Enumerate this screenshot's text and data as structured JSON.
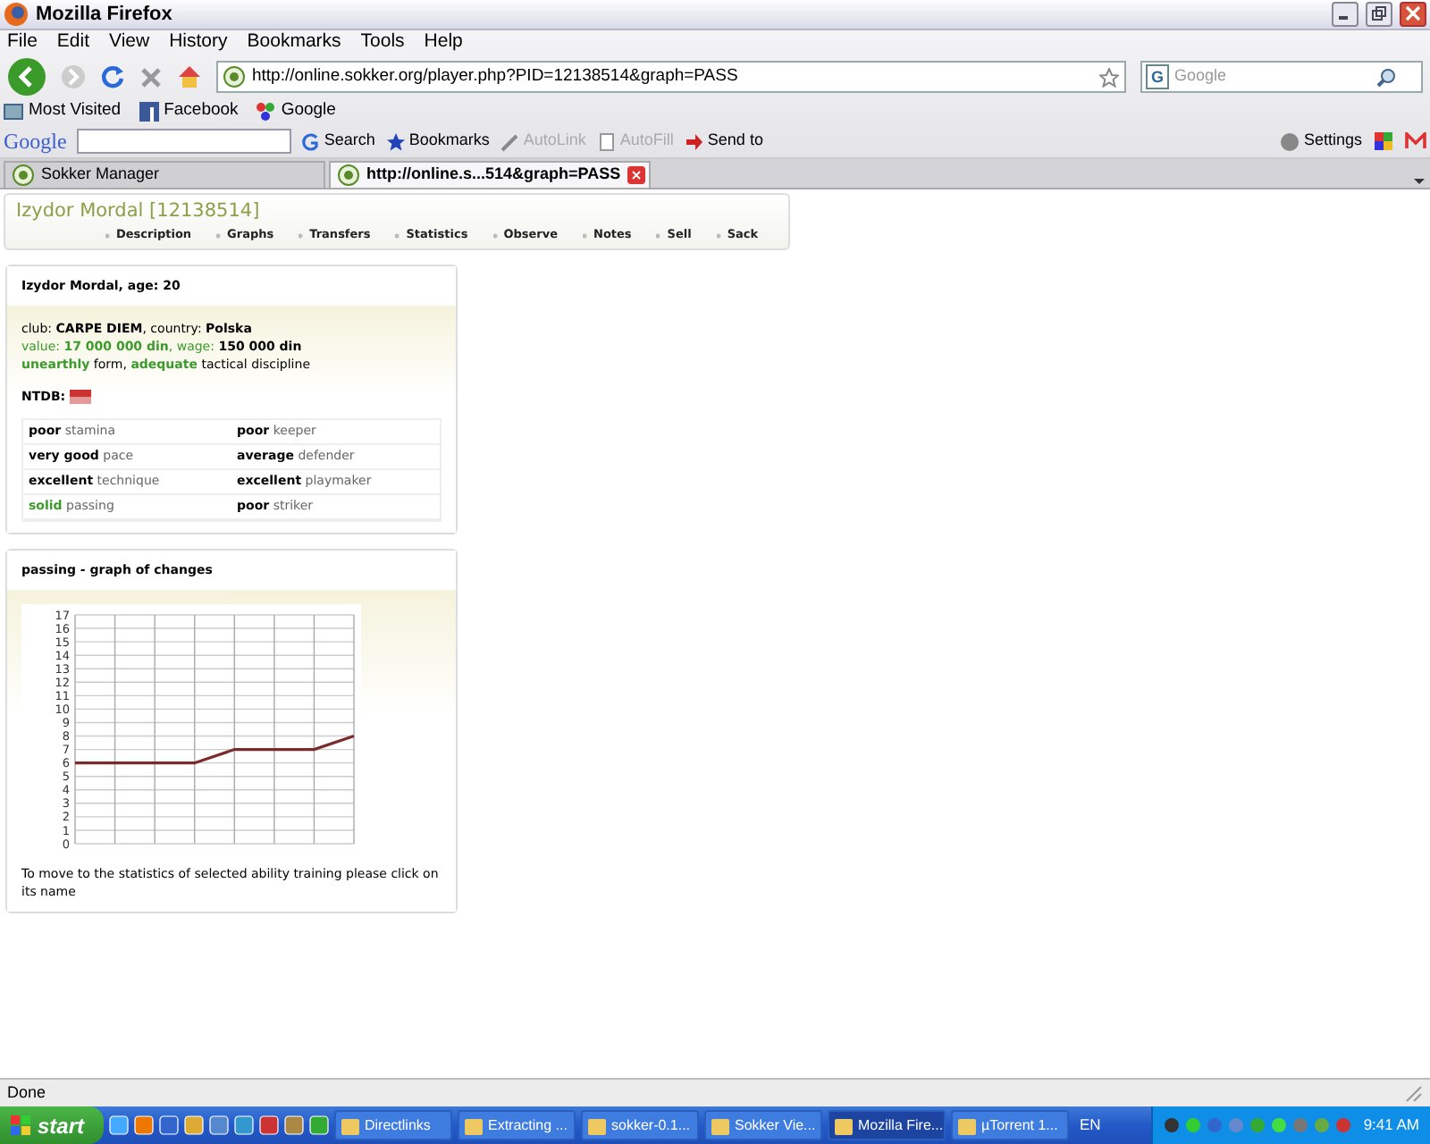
{
  "window": {
    "title": "Mozilla Firefox"
  },
  "menu": [
    "File",
    "Edit",
    "View",
    "History",
    "Bookmarks",
    "Tools",
    "Help"
  ],
  "address_bar": {
    "value": "http://online.sokker.org/player.php?PID=12138514&graph=PASS"
  },
  "search": {
    "engine": "G",
    "placeholder": "Google"
  },
  "bookmarks": [
    "Most Visited",
    "Facebook",
    "Google"
  ],
  "google_toolbar": {
    "logo": "Google",
    "search_label": "Search",
    "items": [
      {
        "label": "Bookmarks",
        "disabled": false
      },
      {
        "label": "AutoLink",
        "disabled": true
      },
      {
        "label": "AutoFill",
        "disabled": true
      },
      {
        "label": "Send to",
        "disabled": false
      }
    ],
    "settings": "Settings"
  },
  "tabs": [
    {
      "label": "Sokker Manager",
      "selected": false
    },
    {
      "label": "http://online.s...514&graph=PASS",
      "selected": true
    }
  ],
  "page": {
    "title": "Izydor Mordal [12138514]",
    "nav": [
      "Description",
      "Graphs",
      "Transfers",
      "Statistics",
      "Observe",
      "Notes",
      "Sell",
      "Sack"
    ],
    "player": {
      "heading": "Izydor Mordal, age: 20",
      "lines": [
        [
          {
            "text": "club: ",
            "kind": "plain"
          },
          {
            "text": "CARPE DIEM",
            "kind": "bold"
          },
          {
            "text": ", country: ",
            "kind": "plain"
          },
          {
            "text": "Polska",
            "kind": "bold"
          }
        ],
        [
          {
            "text": "value: ",
            "kind": "green"
          },
          {
            "text": "17 000 000 din",
            "kind": "greenbold"
          },
          {
            "text": ", wage: ",
            "kind": "green"
          },
          {
            "text": "150 000 din",
            "kind": "bold"
          }
        ],
        [
          {
            "text": "unearthly",
            "kind": "greenbold"
          },
          {
            "text": " form, ",
            "kind": "plain"
          },
          {
            "text": "adequate",
            "kind": "greenbold"
          },
          {
            "text": " tactical discipline",
            "kind": "plain"
          }
        ]
      ],
      "ntdb_label": "NTDB:",
      "skills": [
        {
          "level": "poor",
          "name": "stamina",
          "highlight": false
        },
        {
          "level": "poor",
          "name": "keeper",
          "highlight": false
        },
        {
          "level": "very good",
          "name": "pace",
          "highlight": false
        },
        {
          "level": "average",
          "name": "defender",
          "highlight": false
        },
        {
          "level": "excellent",
          "name": "technique",
          "highlight": false
        },
        {
          "level": "excellent",
          "name": "playmaker",
          "highlight": false
        },
        {
          "level": "solid",
          "name": "passing",
          "highlight": true
        },
        {
          "level": "poor",
          "name": "striker",
          "highlight": false
        }
      ]
    },
    "graph": {
      "title": "passing - graph of changes",
      "chart_data": {
        "type": "line",
        "grid": true,
        "ylim": [
          0,
          17
        ],
        "yticks": [
          0,
          1,
          2,
          3,
          4,
          5,
          6,
          7,
          8,
          9,
          10,
          11,
          12,
          13,
          14,
          15,
          16,
          17
        ],
        "series": [
          {
            "color": "#7a2b2b",
            "values": [
              6,
              6,
              6,
              6,
              7,
              7,
              7,
              8
            ]
          }
        ]
      },
      "note": "To move to the statistics of selected ability training please click on its name"
    }
  },
  "status_bar": "Done",
  "taskbar": {
    "start": "start",
    "tasks": [
      {
        "label": "Directlinks",
        "selected": false
      },
      {
        "label": "Extracting ...",
        "selected": false
      },
      {
        "label": "sokker-0.1...",
        "selected": false
      },
      {
        "label": "Sokker Vie...",
        "selected": false
      },
      {
        "label": "Mozilla Fire...",
        "selected": true
      },
      {
        "label": "µTorrent 1...",
        "selected": false
      }
    ],
    "language": "EN",
    "clock": "9:41 AM"
  }
}
